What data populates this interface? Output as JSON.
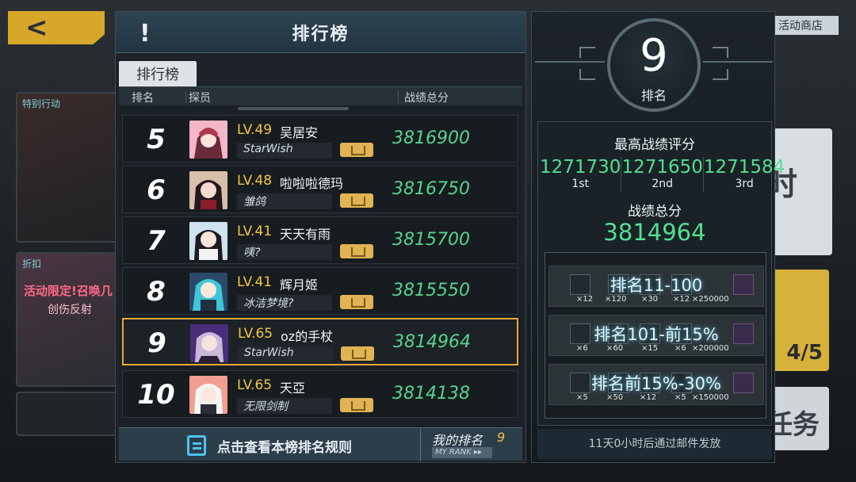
{
  "background": {
    "back_glyph": "<",
    "card1_tag": "特别行动",
    "card2_tag": "折扣",
    "card2_promo": "活动限定!召唤几",
    "card2_promo2": "创伤反射",
    "shop_label": "活动商店",
    "right_card1_text": "时",
    "right_card2_text": "4/5",
    "right_card3_text": "任务"
  },
  "leaderboard": {
    "title": "排行榜",
    "bang": "!",
    "tab_label": "排行榜",
    "col_rank": "排名",
    "col_member": "探员",
    "col_score": "战绩总分",
    "rows": [
      {
        "rank": "5",
        "level": "LV.49",
        "name": "吴居安",
        "guild": "StarWish",
        "score": "3816900",
        "selected": false
      },
      {
        "rank": "6",
        "level": "LV.48",
        "name": "啦啦啦德玛",
        "guild": "雏鸽",
        "score": "3816750",
        "selected": false
      },
      {
        "rank": "7",
        "level": "LV.41",
        "name": "天天有雨",
        "guild": "咦?",
        "score": "3815700",
        "selected": false
      },
      {
        "rank": "8",
        "level": "LV.41",
        "name": "辉月姬",
        "guild": "冰洁梦境?",
        "score": "3815550",
        "selected": false
      },
      {
        "rank": "9",
        "level": "LV.65",
        "name": "oz的手杖",
        "guild": "StarWish",
        "score": "3814964",
        "selected": true
      },
      {
        "rank": "10",
        "level": "LV.65",
        "name": "天亞",
        "guild": "无限剑制",
        "score": "3814138",
        "selected": false
      }
    ],
    "rules_button": "点击查看本榜排名规则",
    "my_rank_label": "我的排名",
    "my_rank_value": "9",
    "my_rank_sub": "MY RANK ▸▸"
  },
  "info": {
    "rank_value": "9",
    "rank_label": "排名",
    "best_title": "最高战绩评分",
    "top3": [
      {
        "value": "1271730",
        "ordinal": "1st"
      },
      {
        "value": "1271650",
        "ordinal": "2nd"
      },
      {
        "value": "1271584",
        "ordinal": "3rd"
      }
    ],
    "total_title": "战绩总分",
    "total_value": "3814964",
    "rewards": [
      {
        "title": "排名11-100",
        "quantities": [
          "×12",
          "×120",
          "×30",
          "×12",
          "×250000"
        ]
      },
      {
        "title": "排名101-前15%",
        "quantities": [
          "×6",
          "×60",
          "×15",
          "×6",
          "×200000"
        ]
      },
      {
        "title": "排名前15%-30%",
        "quantities": [
          "×5",
          "×50",
          "×12",
          "×5",
          "×150000"
        ]
      }
    ],
    "mail_note": "11天0小时后通过邮件发放"
  },
  "colors": {
    "score_green": "#56d48c",
    "level_gold": "#f3c545",
    "selected_border": "#e8a83a"
  }
}
